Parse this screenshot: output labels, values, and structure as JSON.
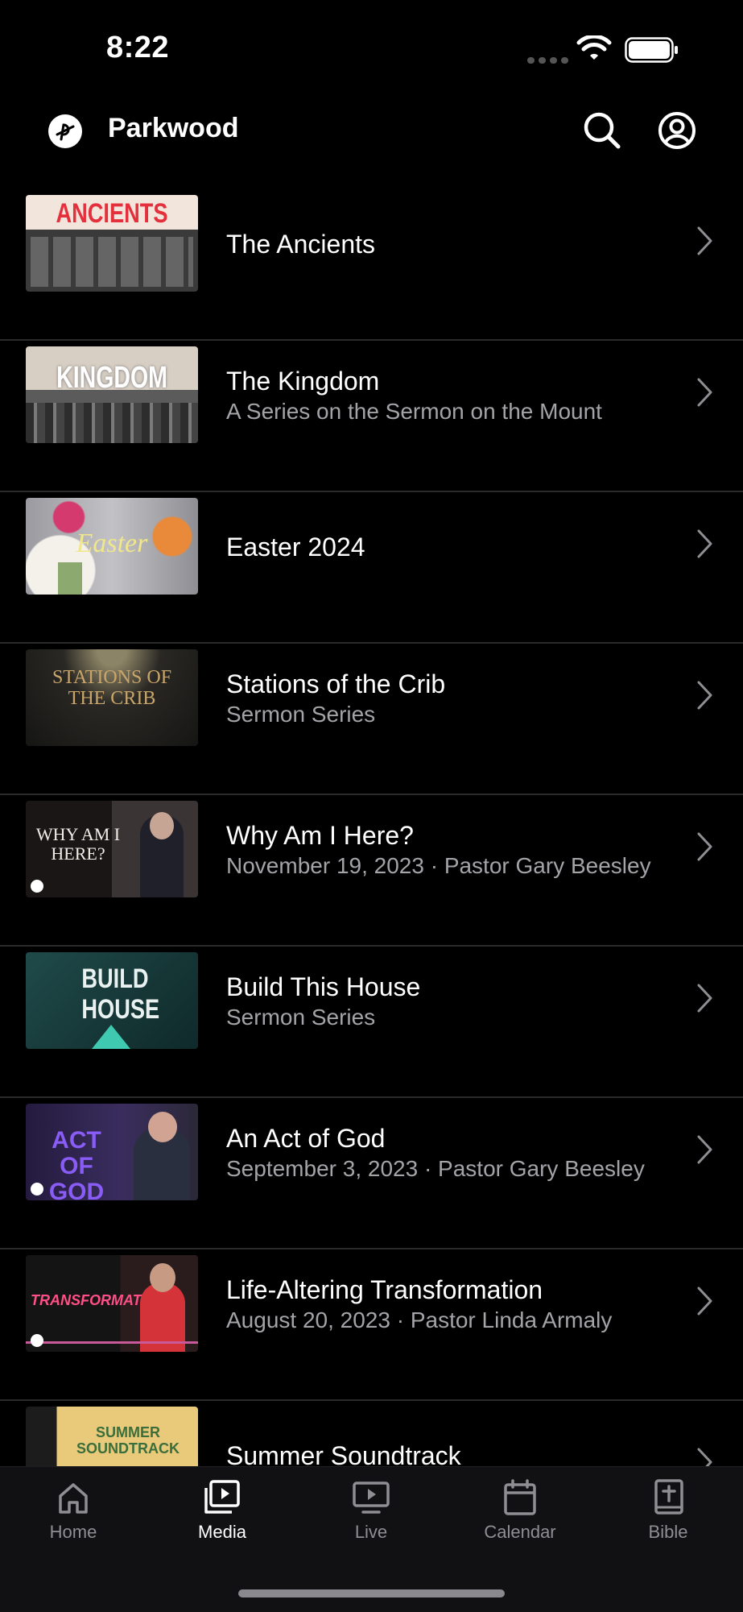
{
  "status_bar": {
    "time": "8:22"
  },
  "header": {
    "app_name": "Parkwood"
  },
  "items": [
    {
      "title": "The Ancients",
      "subtitle": "",
      "thumb_text": "ANCIENTS"
    },
    {
      "title": "The Kingdom",
      "subtitle": "A Series on the Sermon on the Mount",
      "thumb_text": "KINGDOM"
    },
    {
      "title": "Easter 2024",
      "subtitle": "",
      "thumb_text": "Easter"
    },
    {
      "title": "Stations of the Crib",
      "subtitle": "Sermon Series",
      "thumb_text": "STATIONS OF THE CRIB"
    },
    {
      "title": "Why Am I Here?",
      "subtitle": "November 19, 2023 · Pastor Gary Beesley",
      "thumb_text": "WHY AM I HERE?"
    },
    {
      "title": "Build This House",
      "subtitle": "Sermon Series",
      "thumb_text": "BUILD HOUSE"
    },
    {
      "title": "An Act of God",
      "subtitle": "September 3, 2023 · Pastor Gary Beesley",
      "thumb_text": "ACT OF GOD"
    },
    {
      "title": "Life-Altering Transformation",
      "subtitle": "August 20, 2023 · Pastor Linda Armaly",
      "thumb_text": "TRANSFORMATION"
    },
    {
      "title": "Summer Soundtrack",
      "subtitle": "",
      "thumb_text": "SUMMER SOUNDTRACK"
    }
  ],
  "tabs": [
    {
      "label": "Home",
      "icon": "home-icon",
      "active": false
    },
    {
      "label": "Media",
      "icon": "media-icon",
      "active": true
    },
    {
      "label": "Live",
      "icon": "tv-icon",
      "active": false
    },
    {
      "label": "Calendar",
      "icon": "calendar-icon",
      "active": false
    },
    {
      "label": "Bible",
      "icon": "bible-icon",
      "active": false
    }
  ],
  "colors": {
    "background": "#000000",
    "separator": "#2a2a2c",
    "secondary_text": "#a3a3a8",
    "tab_inactive": "#8e8e93"
  }
}
